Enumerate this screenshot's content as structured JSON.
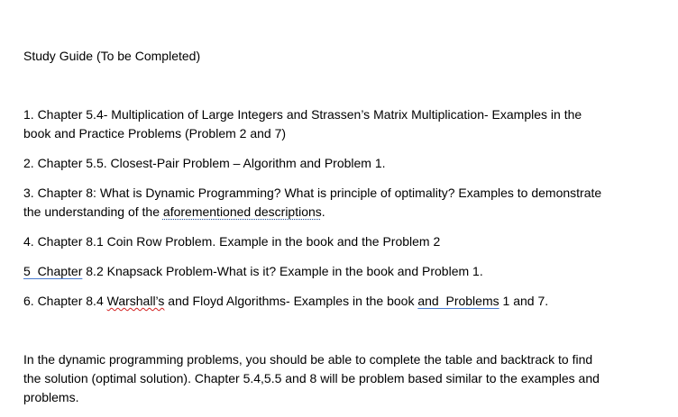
{
  "document": {
    "title": "Study Guide (To be Completed)",
    "item1": {
      "line1": "1. Chapter 5.4- Multiplication of Large Integers and Strassen’s Matrix Multiplication- Examples in the",
      "line2": "book and Practice Problems (Problem 2 and 7)"
    },
    "item2": "2. Chapter 5.5. Closest-Pair Problem – Algorithm and Problem 1.",
    "item3": {
      "line1": "3. Chapter 8: What is Dynamic Programming? What is principle of optimality? Examples to demonstrate",
      "line2_prefix": "the understanding of the ",
      "line2_marked": "aforementioned descriptions",
      "line2_suffix": "."
    },
    "item4": "4. Chapter 8.1 Coin Row Problem. Example in the book and the Problem 2",
    "item5": {
      "marked": "5  Chapter",
      "rest": " 8.2 Knapsack Problem-What is it? Example in the book and Problem 1."
    },
    "item6": {
      "prefix": "6. Chapter 8.4 ",
      "marked1": "Warshall’s",
      "middle": " and Floyd Algorithms- Examples in the book ",
      "marked2": "and  Problems",
      "suffix": " 1 and 7."
    },
    "closing": {
      "line1": "In the dynamic programming problems, you should be able to complete the table and backtrack to find",
      "line2": "the solution (optimal solution). Chapter 5.4,5.5 and 8 will be problem based similar to the examples and",
      "line3": "problems."
    }
  },
  "colors": {
    "background": "#ffffff",
    "text": "#000000",
    "grammar_mark": "#4a7bd0",
    "spelling_mark": "#d21f1f"
  }
}
